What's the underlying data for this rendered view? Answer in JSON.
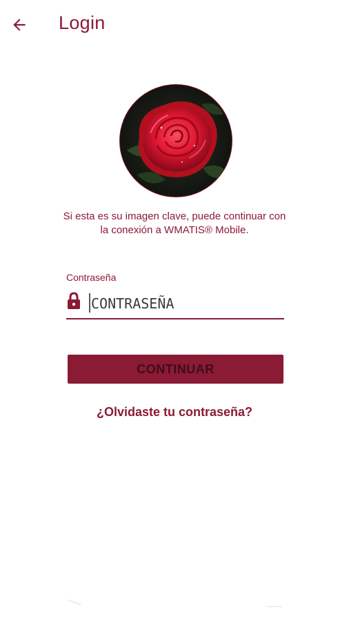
{
  "header": {
    "title": "Login",
    "back_icon": "arrow-left-icon"
  },
  "security_image": {
    "subject": "red rose",
    "icon": "rose-image"
  },
  "caption": "Si esta es su imagen clave, puede continuar con la conexión a WMATIS® Mobile.",
  "password": {
    "label": "Contraseña",
    "placeholder": "CONTRASEÑA",
    "value": "",
    "icon": "lock-icon"
  },
  "continue_button": "CONTINUAR",
  "forgot_link": "¿Olvidaste tu contraseña?",
  "colors": {
    "accent": "#8b1a35",
    "button_text": "#3f0d1a",
    "background": "#ffffff"
  }
}
